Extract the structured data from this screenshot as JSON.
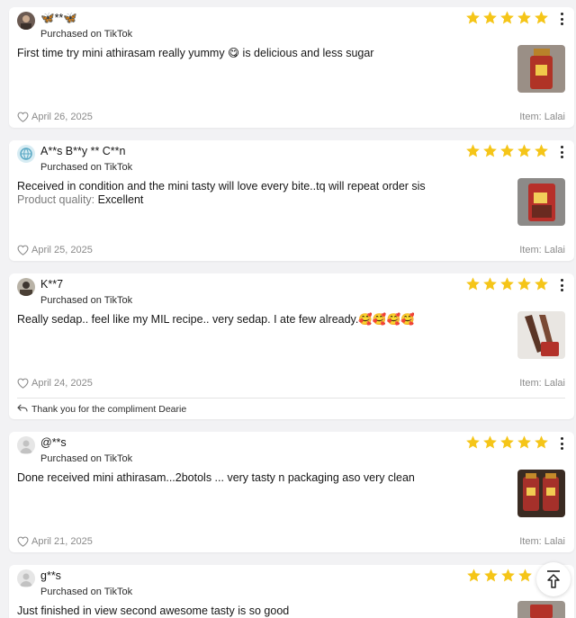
{
  "colors": {
    "star": "#f5c518",
    "muted": "#8a8a8a"
  },
  "reviews": [
    {
      "username": "🦋**🦋",
      "purchased": "Purchased on TikTok",
      "rating": 5,
      "text": "First time try mini athirasam really yummy 😋 is delicious and less sugar",
      "date": "April 26, 2025",
      "item": "Item: Lalai",
      "avatar_icon": "photo-avatar-icon"
    },
    {
      "username": "A**s B**y ** C**n",
      "purchased": "Purchased on TikTok",
      "rating": 5,
      "text": "Received in condition and the mini tasty will love every bite..tq will repeat order sis",
      "quality_label": "Product quality:",
      "quality_value": "Excellent",
      "date": "April 25, 2025",
      "item": "Item: Lalai",
      "avatar_icon": "globe-avatar-icon"
    },
    {
      "username": "K**7",
      "purchased": "Purchased on TikTok",
      "rating": 5,
      "text": "Really sedap.. feel like my MIL recipe.. very sedap. I ate few already.🥰🥰🥰🥰",
      "date": "April 24, 2025",
      "item": "Item: Lalai",
      "reply": "Thank you for the compliment Dearie",
      "avatar_icon": "photo-avatar-icon"
    },
    {
      "username": "@**s",
      "purchased": "Purchased on TikTok",
      "rating": 5,
      "text": "Done received mini athirasam...2botols ... very tasty n packaging aso very clean",
      "date": "April 21, 2025",
      "item": "Item: Lalai",
      "avatar_icon": "default-avatar-icon"
    },
    {
      "username": "g**s",
      "purchased": "Purchased on TikTok",
      "rating": 5,
      "text": "Just finished in view second awesome tasty is so good",
      "date": "",
      "item": "",
      "avatar_icon": "default-avatar-icon"
    }
  ],
  "scroll_top_icon": "arrow-up-to-top-icon"
}
